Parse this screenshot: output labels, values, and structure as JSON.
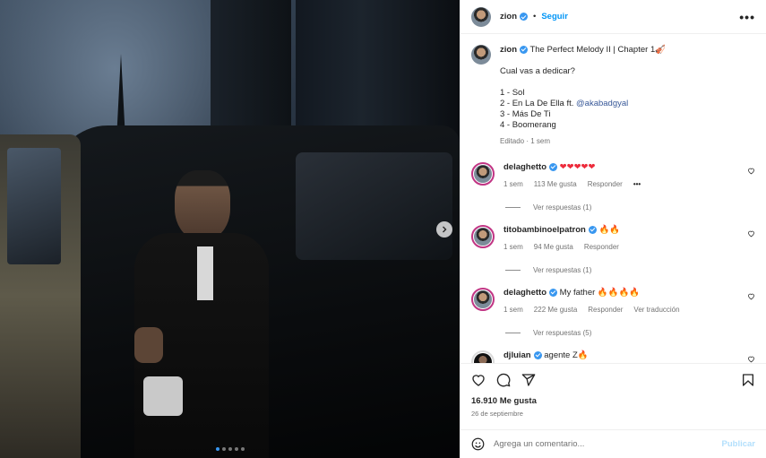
{
  "header": {
    "username": "zion",
    "separator": "•",
    "follow_label": "Seguir",
    "more_label": "•••"
  },
  "caption": {
    "username": "zion",
    "title": "The Perfect Melody II | Chapter 1",
    "title_emoji": "🎻",
    "question": "Cual vas a dedicar?",
    "tracks": [
      "1 - Sol",
      "2 - En La De Ella ft.",
      "3 - Más De Ti",
      "4 - Boomerang"
    ],
    "track2_mention": "@akabadgyal",
    "meta": "Editado · 1 sem"
  },
  "comments": [
    {
      "username": "delaghetto",
      "text": "❤❤❤❤❤",
      "time": "1 sem",
      "likes": "113 Me gusta",
      "reply": "Responder",
      "options": "•••",
      "replies": "Ver respuestas (1)"
    },
    {
      "username": "titobambinoelpatron",
      "text": "🔥🔥",
      "time": "1 sem",
      "likes": "94 Me gusta",
      "reply": "Responder",
      "replies": "Ver respuestas (1)"
    },
    {
      "username": "delaghetto",
      "text": "My father 🔥🔥🔥🔥",
      "time": "1 sem",
      "likes": "222 Me gusta",
      "reply": "Responder",
      "translate": "Ver traducción",
      "replies": "Ver respuestas (5)"
    },
    {
      "username": "djluian",
      "text": "agente Z🔥"
    }
  ],
  "actions": {
    "likes": "16.910 Me gusta",
    "date": "26 de septiembre"
  },
  "add_comment": {
    "placeholder": "Agrega un comentario...",
    "publish_label": "Publicar"
  },
  "carousel": {
    "current_index": 1,
    "count": 5
  },
  "colors": {
    "accent": "#0095f6",
    "verified": "#3897f0",
    "publish_disabled": "#b2dffc"
  }
}
